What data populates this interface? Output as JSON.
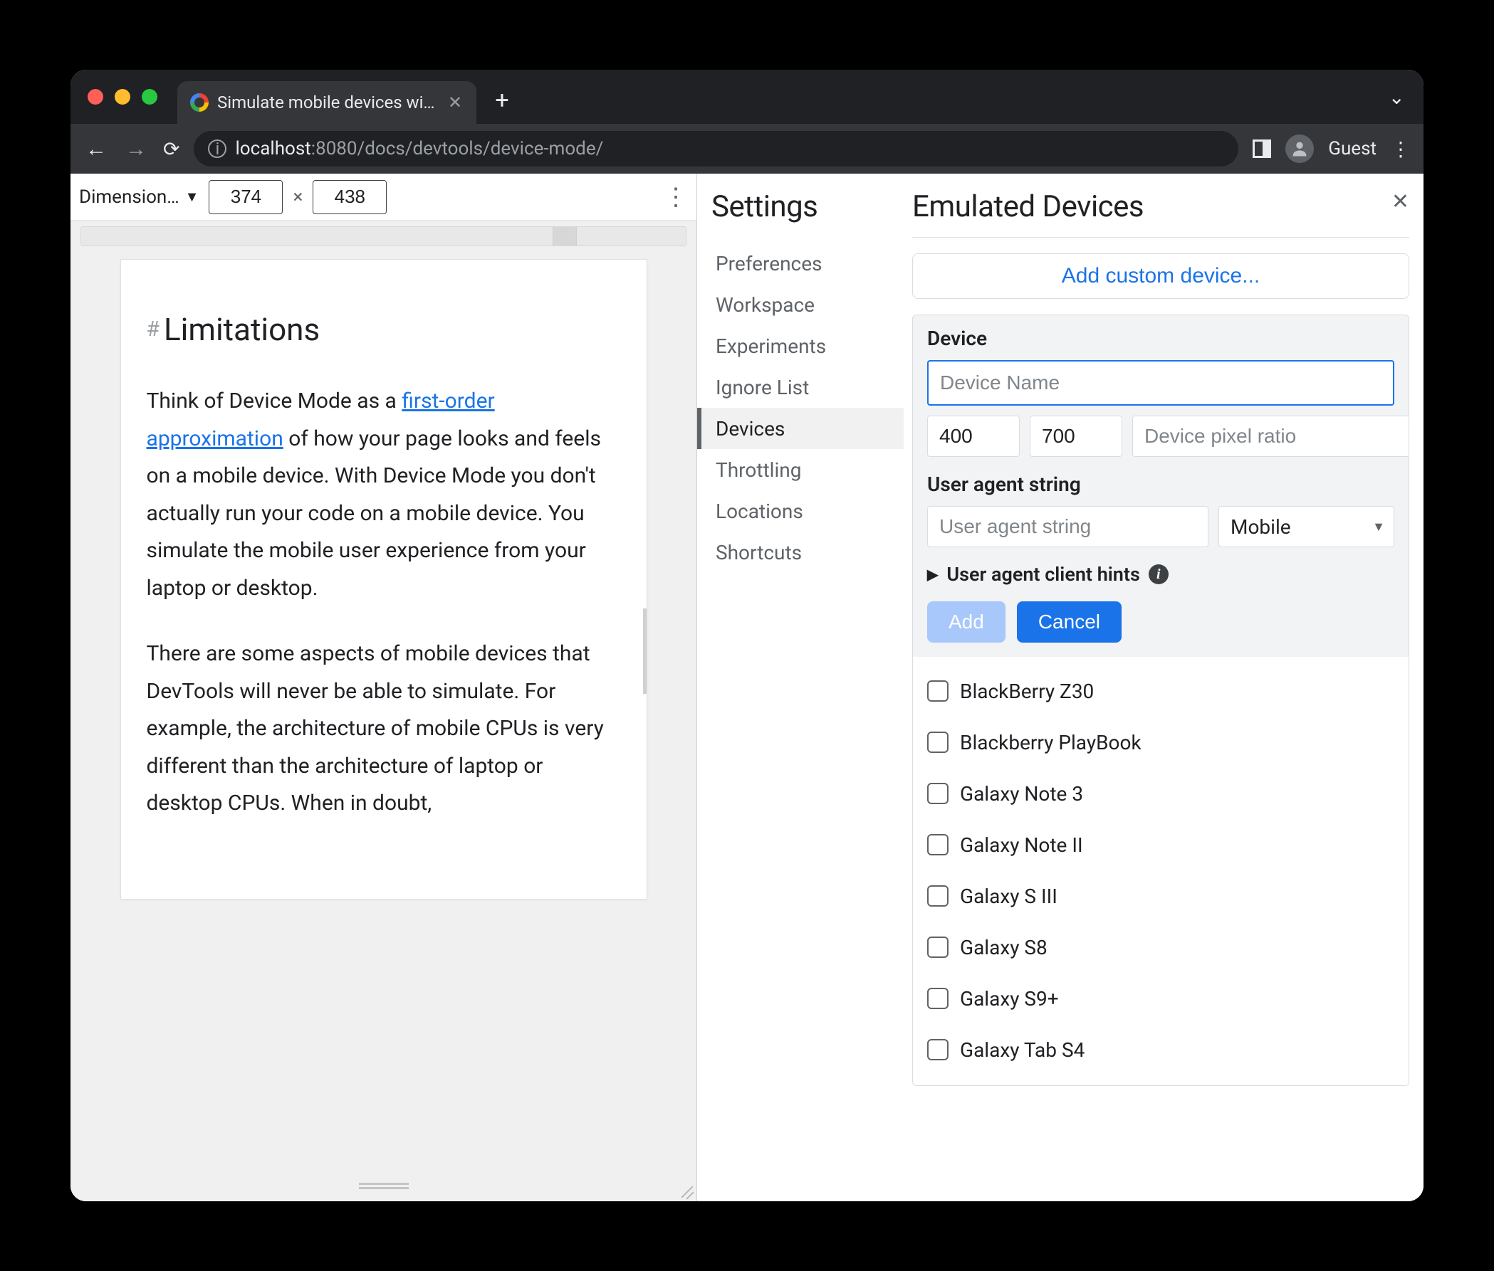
{
  "tab": {
    "title": "Simulate mobile devices with D"
  },
  "toolbar": {
    "guest_label": "Guest",
    "url_prefix": "localhost",
    "url_port": ":8080",
    "url_path": "/docs/devtools/device-mode/"
  },
  "device_toolbar": {
    "dimension_label": "Dimension…",
    "width": "374",
    "height": "438",
    "x": "×"
  },
  "page_content": {
    "heading": "Limitations",
    "p1_a": "Think of Device Mode as a ",
    "p1_link": "first-order approximation",
    "p1_b": " of how your page looks and feels on a mobile device. With Device Mode you don't actually run your code on a mobile device. You simulate the mobile user experience from your laptop or desktop.",
    "p2": "There are some aspects of mobile devices that DevTools will never be able to simulate. For example, the architecture of mobile CPUs is very different than the architecture of laptop or desktop CPUs. When in doubt,"
  },
  "settings": {
    "title": "Settings",
    "items": [
      "Preferences",
      "Workspace",
      "Experiments",
      "Ignore List",
      "Devices",
      "Throttling",
      "Locations",
      "Shortcuts"
    ],
    "selected": "Devices"
  },
  "panel": {
    "title": "Emulated Devices",
    "add_custom": "Add custom device...",
    "device_label": "Device",
    "device_name_placeholder": "Device Name",
    "width_value": "400",
    "height_value": "700",
    "dpr_placeholder": "Device pixel ratio",
    "ua_label": "User agent string",
    "ua_placeholder": "User agent string",
    "ua_type": "Mobile",
    "client_hints": "User agent client hints",
    "add_btn": "Add",
    "cancel_btn": "Cancel",
    "devices": [
      "BlackBerry Z30",
      "Blackberry PlayBook",
      "Galaxy Note 3",
      "Galaxy Note II",
      "Galaxy S III",
      "Galaxy S8",
      "Galaxy S9+",
      "Galaxy Tab S4"
    ]
  }
}
